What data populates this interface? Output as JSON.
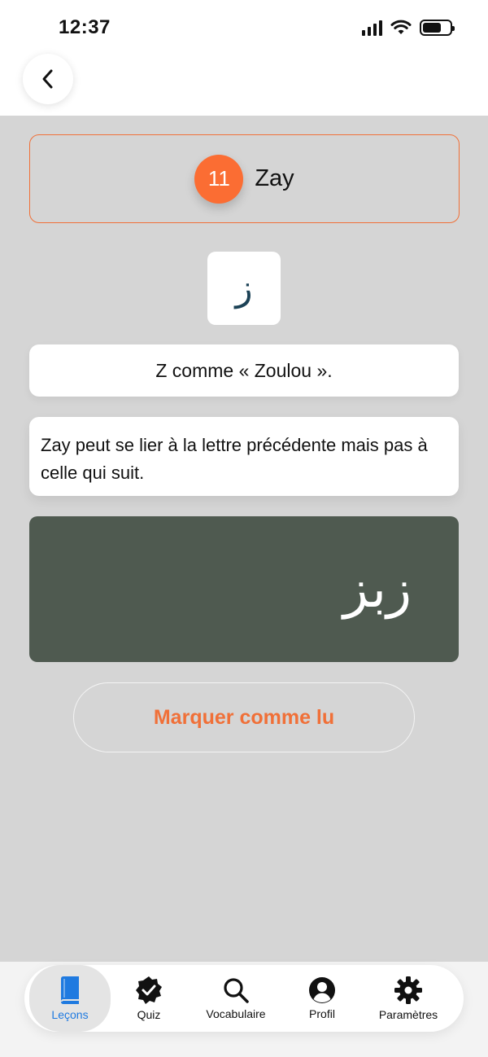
{
  "status_bar": {
    "time": "12:37"
  },
  "letter": {
    "number": "11",
    "name": "Zay",
    "glyph": "ز"
  },
  "pronunciation": "Z comme « Zoulou ».",
  "description": "Zay peut se lier à la lettre précédente mais pas à celle qui suit.",
  "example_word": "زبز",
  "mark_button_label": "Marquer comme lu",
  "colors": {
    "accent": "#fb6d33",
    "example_bg": "#4f5a50",
    "tab_active": "#1f7ae0"
  },
  "tabs": [
    {
      "label": "Leçons",
      "icon": "book-icon",
      "active": true
    },
    {
      "label": "Quiz",
      "icon": "check-badge-icon",
      "active": false
    },
    {
      "label": "Vocabulaire",
      "icon": "search-icon",
      "active": false
    },
    {
      "label": "Profil",
      "icon": "person-circle-icon",
      "active": false
    },
    {
      "label": "Paramètres",
      "icon": "gear-icon",
      "active": false
    }
  ]
}
